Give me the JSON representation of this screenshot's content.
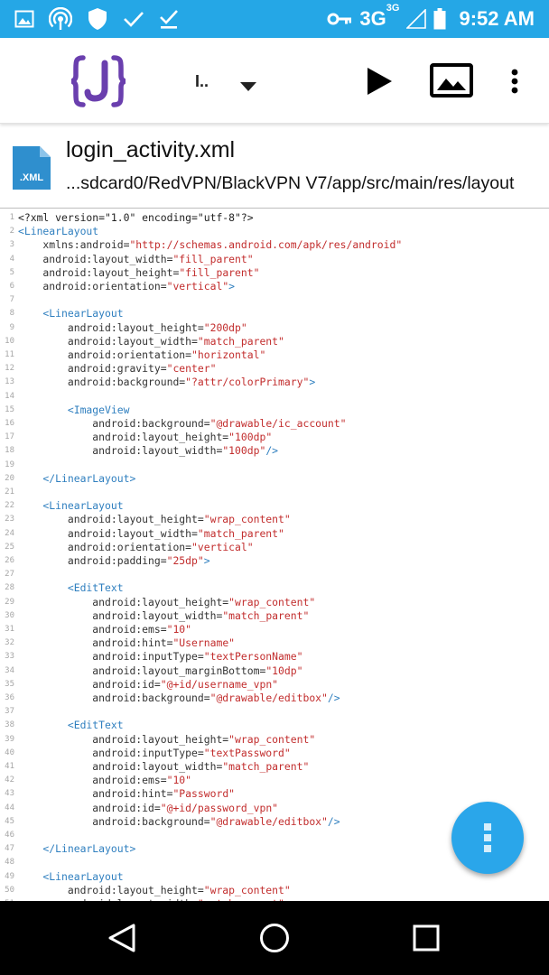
{
  "status_bar": {
    "network": "3G",
    "network_sup": "3G",
    "time": "9:52 AM",
    "icons": [
      "image-icon",
      "hotspot-icon",
      "shield-icon",
      "check-icon",
      "download-done-icon",
      "key-icon",
      "signal-icon",
      "battery-icon"
    ]
  },
  "app_bar": {
    "logo_icon": "json-braces-logo",
    "file_selector": "I..",
    "actions": [
      "play-icon",
      "image-icon",
      "more-vert-icon"
    ]
  },
  "file": {
    "icon_label": ".XML",
    "name": "login_activity.xml",
    "path": "...sdcard0/RedVPN/BlackVPN V7/app/src/main/res/layout"
  },
  "code_lines": [
    [
      [
        "p",
        "<?xml version=\"1.0\" encoding=\"utf-8\"?>"
      ]
    ],
    [
      [
        "t",
        "<LinearLayout"
      ]
    ],
    [
      [
        "a",
        "    xmlns:android="
      ],
      [
        "v",
        "\"http://schemas.android.com/apk/res/android\""
      ]
    ],
    [
      [
        "a",
        "    android:layout_width="
      ],
      [
        "v",
        "\"fill_parent\""
      ]
    ],
    [
      [
        "a",
        "    android:layout_height="
      ],
      [
        "v",
        "\"fill_parent\""
      ]
    ],
    [
      [
        "a",
        "    android:orientation="
      ],
      [
        "v",
        "\"vertical\""
      ],
      [
        "t",
        ">"
      ]
    ],
    [],
    [
      [
        "t",
        "    <LinearLayout"
      ]
    ],
    [
      [
        "a",
        "        android:layout_height="
      ],
      [
        "v",
        "\"200dp\""
      ]
    ],
    [
      [
        "a",
        "        android:layout_width="
      ],
      [
        "v",
        "\"match_parent\""
      ]
    ],
    [
      [
        "a",
        "        android:orientation="
      ],
      [
        "v",
        "\"horizontal\""
      ]
    ],
    [
      [
        "a",
        "        android:gravity="
      ],
      [
        "v",
        "\"center\""
      ]
    ],
    [
      [
        "a",
        "        android:background="
      ],
      [
        "v",
        "\"?attr/colorPrimary\""
      ],
      [
        "t",
        ">"
      ]
    ],
    [],
    [
      [
        "t",
        "        <ImageView"
      ]
    ],
    [
      [
        "a",
        "            android:background="
      ],
      [
        "v",
        "\"@drawable/ic_account\""
      ]
    ],
    [
      [
        "a",
        "            android:layout_height="
      ],
      [
        "v",
        "\"100dp\""
      ]
    ],
    [
      [
        "a",
        "            android:layout_width="
      ],
      [
        "v",
        "\"100dp\""
      ],
      [
        "t",
        "/>"
      ]
    ],
    [],
    [
      [
        "t",
        "    </LinearLayout>"
      ]
    ],
    [],
    [
      [
        "t",
        "    <LinearLayout"
      ]
    ],
    [
      [
        "a",
        "        android:layout_height="
      ],
      [
        "v",
        "\"wrap_content\""
      ]
    ],
    [
      [
        "a",
        "        android:layout_width="
      ],
      [
        "v",
        "\"match_parent\""
      ]
    ],
    [
      [
        "a",
        "        android:orientation="
      ],
      [
        "v",
        "\"vertical\""
      ]
    ],
    [
      [
        "a",
        "        android:padding="
      ],
      [
        "v",
        "\"25dp\""
      ],
      [
        "t",
        ">"
      ]
    ],
    [],
    [
      [
        "t",
        "        <EditText"
      ]
    ],
    [
      [
        "a",
        "            android:layout_height="
      ],
      [
        "v",
        "\"wrap_content\""
      ]
    ],
    [
      [
        "a",
        "            android:layout_width="
      ],
      [
        "v",
        "\"match_parent\""
      ]
    ],
    [
      [
        "a",
        "            android:ems="
      ],
      [
        "v",
        "\"10\""
      ]
    ],
    [
      [
        "a",
        "            android:hint="
      ],
      [
        "v",
        "\"Username\""
      ]
    ],
    [
      [
        "a",
        "            android:inputType="
      ],
      [
        "v",
        "\"textPersonName\""
      ]
    ],
    [
      [
        "a",
        "            android:layout_marginBottom="
      ],
      [
        "v",
        "\"10dp\""
      ]
    ],
    [
      [
        "a",
        "            android:id="
      ],
      [
        "v",
        "\"@+id/username_vpn\""
      ]
    ],
    [
      [
        "a",
        "            android:background="
      ],
      [
        "v",
        "\"@drawable/editbox\""
      ],
      [
        "t",
        "/>"
      ]
    ],
    [],
    [
      [
        "t",
        "        <EditText"
      ]
    ],
    [
      [
        "a",
        "            android:layout_height="
      ],
      [
        "v",
        "\"wrap_content\""
      ]
    ],
    [
      [
        "a",
        "            android:inputType="
      ],
      [
        "v",
        "\"textPassword\""
      ]
    ],
    [
      [
        "a",
        "            android:layout_width="
      ],
      [
        "v",
        "\"match_parent\""
      ]
    ],
    [
      [
        "a",
        "            android:ems="
      ],
      [
        "v",
        "\"10\""
      ]
    ],
    [
      [
        "a",
        "            android:hint="
      ],
      [
        "v",
        "\"Password\""
      ]
    ],
    [
      [
        "a",
        "            android:id="
      ],
      [
        "v",
        "\"@+id/password_vpn\""
      ]
    ],
    [
      [
        "a",
        "            android:background="
      ],
      [
        "v",
        "\"@drawable/editbox\""
      ],
      [
        "t",
        "/>"
      ]
    ],
    [],
    [
      [
        "t",
        "    </LinearLayout>"
      ]
    ],
    [],
    [
      [
        "t",
        "    <LinearLayout"
      ]
    ],
    [
      [
        "a",
        "        android:layout_height="
      ],
      [
        "v",
        "\"wrap_content\""
      ]
    ],
    [
      [
        "a",
        "        android:layout_width="
      ],
      [
        "v",
        "\"match_parent\""
      ]
    ]
  ],
  "fab": {
    "icon": "more-vert-icon"
  },
  "nav_bar": {
    "buttons": [
      "back-icon",
      "home-icon",
      "recents-icon"
    ]
  },
  "colors": {
    "status_bar": "#25a7e6",
    "logo": "#6a3fae",
    "tag": "#2f7fbf",
    "value": "#c22d2d",
    "fab": "#2aa6ea"
  }
}
